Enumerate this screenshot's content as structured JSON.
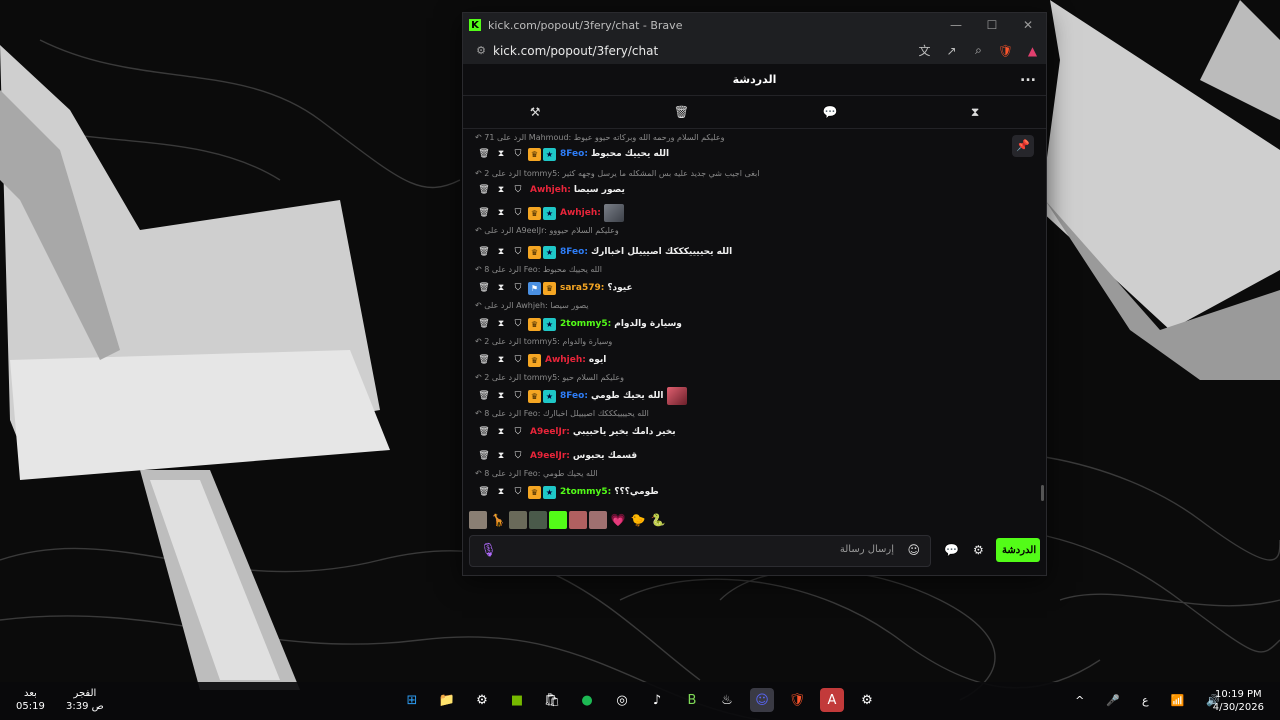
{
  "window": {
    "title": "kick.com/popout/3fery/chat - Brave",
    "url": "kick.com/popout/3fery/chat"
  },
  "chat": {
    "header_title": "الدردشة",
    "more_label": "...",
    "send_label": "الدردشة",
    "input_placeholder": "إرسال رسالة"
  },
  "messages": [
    {
      "reply": "الرد على Mahmoud: وعليكم السلام ورحمه الله وبركاته حيوو عيوط",
      "reply_count": "71"
    },
    {
      "user": "8Feo",
      "color": "#2e7df7",
      "text": "الله يحييك محبوط",
      "badges": [
        "crown",
        "sub"
      ]
    },
    {
      "reply": "الرد على tommy5: ابغى اجيب شي جديد عليه بس المشكله ما يرسل وجهه كثير",
      "reply_count": "2"
    },
    {
      "user": "Awhjeh",
      "color": "#e8253a",
      "text": "يصور سيصا",
      "badges": []
    },
    {
      "user": "Awhjeh",
      "color": "#e8253a",
      "text": "",
      "badges": [
        "crown",
        "sub"
      ],
      "emote": true
    },
    {
      "reply": "الرد على A9eelJr: وعليكم السلام حيووو",
      "reply_count": ""
    },
    {
      "user": "8Feo",
      "color": "#2e7df7",
      "text": "الله يحييييكككك اصيييلل اخباارك",
      "badges": [
        "crown",
        "sub"
      ]
    },
    {
      "reply": "الرد على Feo: الله يحييك محبوط",
      "reply_count": "8"
    },
    {
      "user": "sara579",
      "color": "#f5a623",
      "text": "عيود؟",
      "badges": [
        "vip",
        "crown"
      ]
    },
    {
      "reply": "الرد على Awhjeh: يصور سيصا",
      "reply_count": ""
    },
    {
      "user": "2tommy5",
      "color": "#53fc18",
      "text": "وسيارة والدوام",
      "badges": [
        "crown",
        "sub"
      ]
    },
    {
      "reply": "الرد على tommy5: وسيارة والدوام",
      "reply_count": "2"
    },
    {
      "user": "Awhjeh",
      "color": "#e8253a",
      "text": "ايوه",
      "badges": [
        "crown"
      ]
    },
    {
      "reply": "الرد على tommy5: وعليكم السلام حيو",
      "reply_count": "2"
    },
    {
      "user": "8Feo",
      "color": "#2e7df7",
      "text": "الله يحيك طومي",
      "badges": [
        "crown",
        "sub"
      ],
      "emote_after": true
    },
    {
      "reply": "الرد على Feo: الله يحييييكككك اصيييلل اخباارك",
      "reply_count": "8"
    },
    {
      "user": "A9eelJr",
      "color": "#e8253a",
      "text": "بخير دامك بخير ياحبيبي",
      "badges": []
    },
    {
      "user": "A9eelJr",
      "color": "#e8253a",
      "text": "قسمك يحبوس",
      "badges": []
    },
    {
      "reply": "الرد على Feo: الله يحيك طومي",
      "reply_count": "8"
    },
    {
      "user": "2tommy5",
      "color": "#53fc18",
      "text": "طومي؟؟؟",
      "badges": [
        "crown",
        "sub"
      ]
    }
  ],
  "taskbar": {
    "prayer_label": "الفجر",
    "prayer_time": "3:39 ص",
    "after_label": "بعد",
    "after_time": "05:19",
    "time": "10:19 PM",
    "date": "4/30/2026",
    "lang": "ع"
  }
}
